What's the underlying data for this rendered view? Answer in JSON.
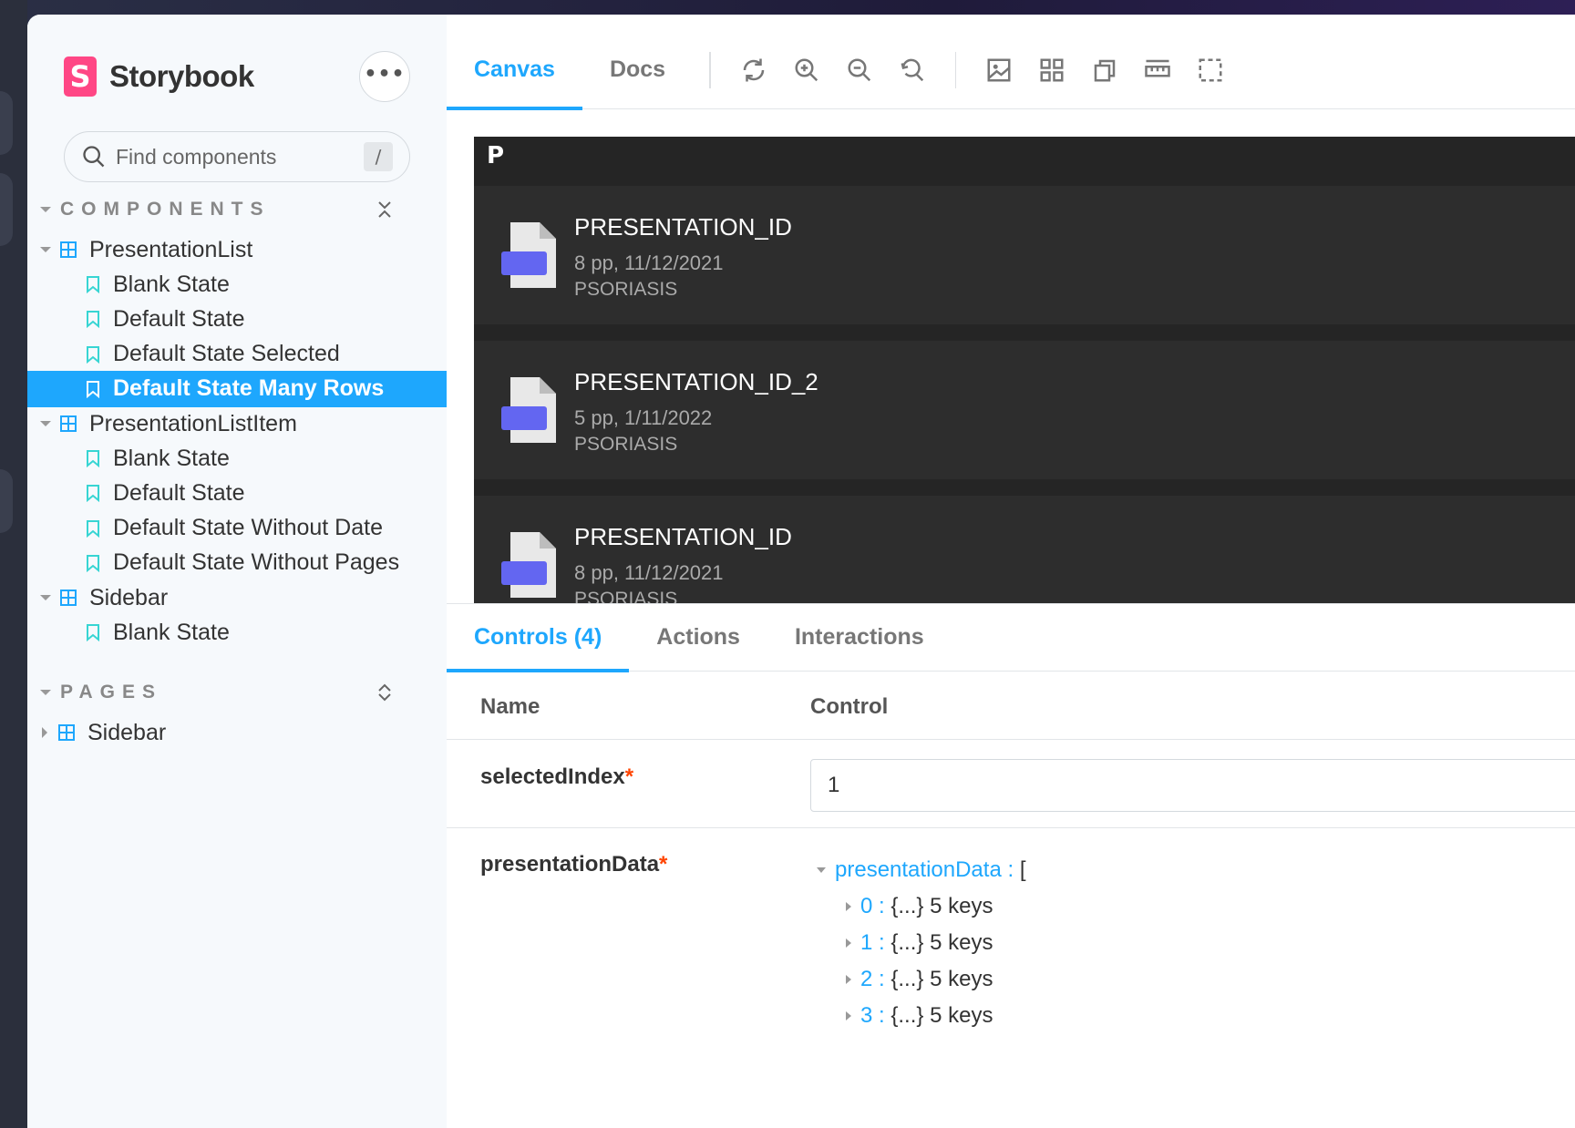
{
  "sidebar": {
    "brand": {
      "logo_letter": "S",
      "name": "Storybook"
    },
    "more_label": "•••",
    "search": {
      "placeholder": "Find components",
      "shortcut": "/"
    },
    "sections": {
      "components": "COMPONENTS",
      "pages": "PAGES"
    },
    "tree": [
      {
        "kind": "component",
        "label": "PresentationList",
        "expanded": true
      },
      {
        "kind": "story",
        "label": "Blank State"
      },
      {
        "kind": "story",
        "label": "Default State"
      },
      {
        "kind": "story",
        "label": "Default State Selected"
      },
      {
        "kind": "story",
        "label": "Default State Many Rows",
        "selected": true
      },
      {
        "kind": "component",
        "label": "PresentationListItem",
        "expanded": true
      },
      {
        "kind": "story",
        "label": "Blank State"
      },
      {
        "kind": "story",
        "label": "Default State"
      },
      {
        "kind": "story",
        "label": "Default State Without Date"
      },
      {
        "kind": "story",
        "label": "Default State Without Pages"
      },
      {
        "kind": "component",
        "label": "Sidebar",
        "expanded": true
      },
      {
        "kind": "story",
        "label": "Blank State"
      }
    ],
    "pages_tree": [
      {
        "kind": "component",
        "label": "Sidebar",
        "expanded": false
      }
    ]
  },
  "toolbar": {
    "tabs": [
      "Canvas",
      "Docs"
    ],
    "active_tab": "Canvas",
    "tools": [
      "sync-icon",
      "zoom-in-icon",
      "zoom-out-icon",
      "zoom-reset-icon",
      "background-icon",
      "grid-icon",
      "viewport-icon",
      "measure-icon",
      "outline-icon"
    ]
  },
  "preview": {
    "title": "P",
    "items": [
      {
        "name": "PRESENTATION_ID",
        "meta": "8 pp, 11/12/2021",
        "tag": "PSORIASIS"
      },
      {
        "name": "PRESENTATION_ID_2",
        "meta": "5 pp, 1/11/2022",
        "tag": "PSORIASIS"
      },
      {
        "name": "PRESENTATION_ID",
        "meta": "8 pp, 11/12/2021",
        "tag": "PSORIASIS"
      }
    ]
  },
  "addons": {
    "tabs": [
      "Controls (4)",
      "Actions",
      "Interactions"
    ],
    "active_tab": "Controls (4)",
    "headers": {
      "name": "Name",
      "control": "Control"
    },
    "rows": {
      "selectedIndex": {
        "name": "selectedIndex",
        "required": "*",
        "value": "1"
      },
      "presentationData": {
        "name": "presentationData",
        "required": "*",
        "root_key": "presentationData",
        "root_sep": " : ",
        "root_open": "[",
        "entries": [
          {
            "key": "0",
            "summary": "{...} 5 keys"
          },
          {
            "key": "1",
            "summary": "{...} 5 keys"
          },
          {
            "key": "2",
            "summary": "{...} 5 keys"
          },
          {
            "key": "3",
            "summary": "{...} 5 keys"
          }
        ]
      }
    }
  },
  "colors": {
    "accent": "#1ea7fd",
    "brand": "#ff4785",
    "doc_badge": "#6366f1",
    "required": "#ff4400"
  }
}
